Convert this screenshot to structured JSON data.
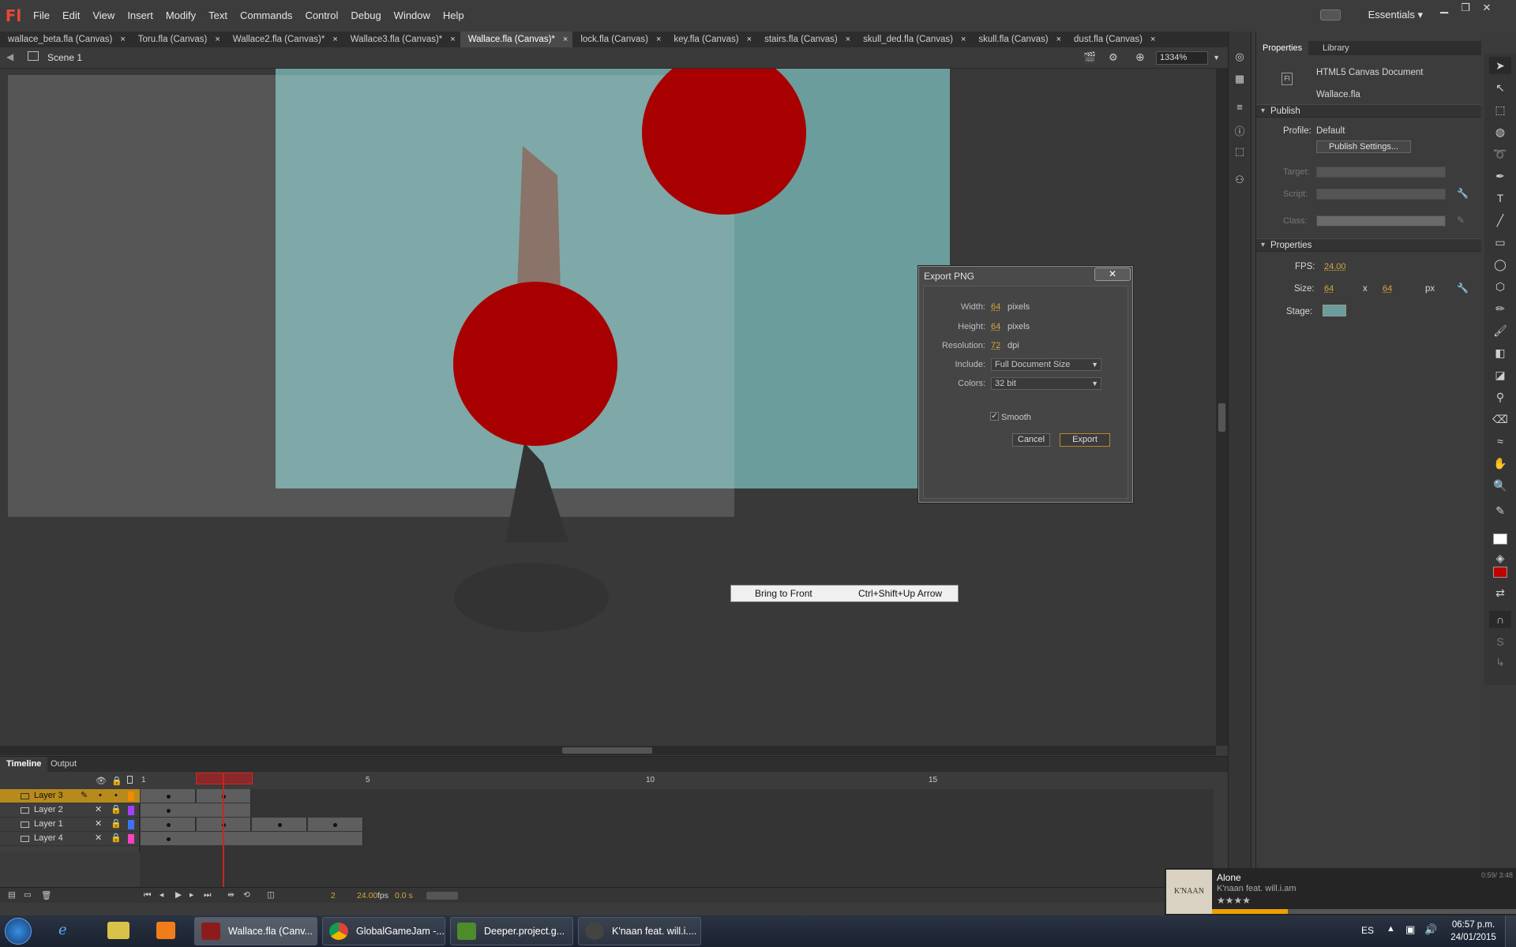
{
  "app": {
    "logo": "Fl"
  },
  "menu": [
    "File",
    "Edit",
    "View",
    "Insert",
    "Modify",
    "Text",
    "Commands",
    "Control",
    "Debug",
    "Window",
    "Help"
  ],
  "workspace": "Essentials",
  "tabs": [
    {
      "label": "wallace_beta.fla (Canvas)",
      "active": false
    },
    {
      "label": "Toru.fla (Canvas)",
      "active": false
    },
    {
      "label": "Wallace2.fla (Canvas)*",
      "active": false
    },
    {
      "label": "Wallace3.fla (Canvas)*",
      "active": false
    },
    {
      "label": "Wallace.fla (Canvas)*",
      "active": true
    },
    {
      "label": "lock.fla (Canvas)",
      "active": false
    },
    {
      "label": "key.fla (Canvas)",
      "active": false
    },
    {
      "label": "stairs.fla (Canvas)",
      "active": false
    },
    {
      "label": "skull_ded.fla (Canvas)",
      "active": false
    },
    {
      "label": "skull.fla (Canvas)",
      "active": false
    },
    {
      "label": "dust.fla (Canvas)",
      "active": false
    }
  ],
  "editbar": {
    "scene": "Scene 1",
    "zoom": "1334%"
  },
  "dialog": {
    "title": "Export PNG",
    "width_label": "Width:",
    "width": "64",
    "width_unit": "pixels",
    "height_label": "Height:",
    "height": "64",
    "height_unit": "pixels",
    "resolution_label": "Resolution:",
    "resolution": "72",
    "resolution_unit": "dpi",
    "include_label": "Include:",
    "include": "Full Document Size",
    "colors_label": "Colors:",
    "colors": "32 bit",
    "smooth_label": "Smooth",
    "smooth_checked": true,
    "cancel": "Cancel",
    "export": "Export"
  },
  "context_menu": {
    "label": "Bring to Front",
    "shortcut": "Ctrl+Shift+Up Arrow"
  },
  "properties": {
    "tab_properties": "Properties",
    "tab_library": "Library",
    "doc_type": "HTML5 Canvas Document",
    "doc_name": "Wallace.fla",
    "publish_section": "Publish",
    "profile_label": "Profile:",
    "profile": "Default",
    "publish_settings": "Publish Settings...",
    "target_label": "Target:",
    "script_label": "Script:",
    "class_label": "Class:",
    "props_section": "Properties",
    "fps_label": "FPS:",
    "fps": "24.00",
    "size_label": "Size:",
    "size_w": "64",
    "size_x": "x",
    "size_h": "64",
    "size_unit": "px",
    "stage_label": "Stage:",
    "stage_color": "#6b9d9d"
  },
  "timeline": {
    "tab_timeline": "Timeline",
    "tab_output": "Output",
    "markers": [
      "1",
      "5",
      "10",
      "15"
    ],
    "layers": [
      {
        "name": "Layer 3",
        "color": "#f08a00",
        "selected": true
      },
      {
        "name": "Layer 2",
        "color": "#a040ff",
        "selected": false
      },
      {
        "name": "Layer 1",
        "color": "#4070ff",
        "selected": false
      },
      {
        "name": "Layer 4",
        "color": "#ff40c0",
        "selected": false
      }
    ],
    "current_frame": "2",
    "fps": "24.00",
    "fps_unit": "fps",
    "time": "0.0 s"
  },
  "media": {
    "title": "Alone",
    "artist": "K'naan feat. will.i.am",
    "time": "0:59/ 3:48",
    "album_text": "K'NAAN",
    "progress": 0.25
  },
  "taskbar": {
    "items": [
      "Wallace.fla (Canv...",
      "GlobalGameJam -...",
      "Deeper.project.g...",
      "K'naan feat. will.i...."
    ],
    "lang": "ES",
    "time": "06:57 p.m.",
    "date": "24/01/2015"
  },
  "colors": {
    "accent": "#d4a63c",
    "stage": "#6b9d9d",
    "red": "#a80000"
  }
}
